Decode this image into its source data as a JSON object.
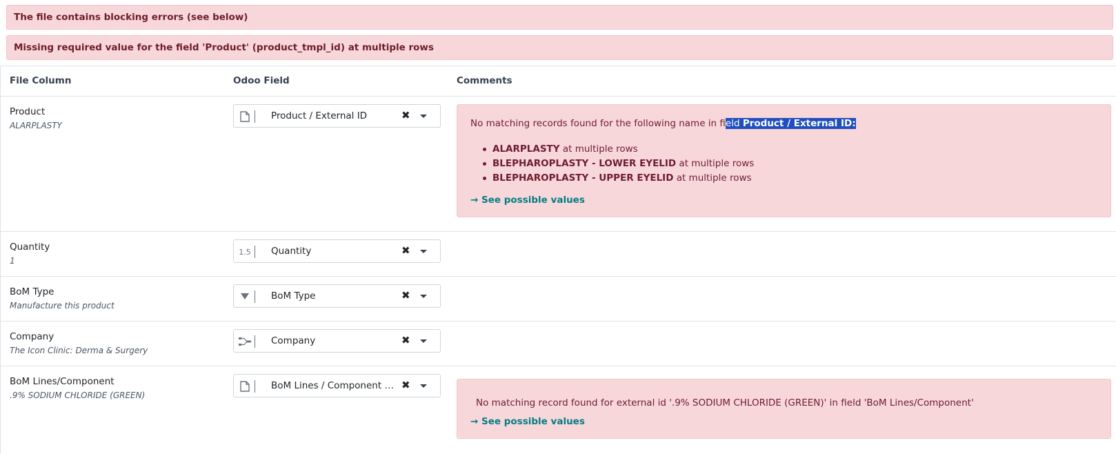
{
  "alerts": {
    "blocking": "The file contains blocking errors (see below)",
    "missing": "Missing required value for the field 'Product' (product_tmpl_id) at multiple rows"
  },
  "table": {
    "headers": {
      "file_column": "File Column",
      "odoo_field": "Odoo Field",
      "comments": "Comments"
    },
    "rows": [
      {
        "name": "Product",
        "sample": "ALARPLASTY",
        "field": "Product / External ID",
        "icon": "file-icon"
      },
      {
        "name": "Quantity",
        "sample": "1",
        "field": "Quantity",
        "icon": "float-icon",
        "icon_text": "1.5"
      },
      {
        "name": "BoM Type",
        "sample": "Manufacture this product",
        "field": "BoM Type",
        "icon": "selection-icon"
      },
      {
        "name": "Company",
        "sample": "The Icon Clinic: Derma & Surgery",
        "field": "Company",
        "icon": "many2one-icon"
      },
      {
        "name": "BoM Lines/Component",
        "sample": ".9% SODIUM CHLORIDE (GREEN)",
        "field": "BoM Lines / Component / External ID",
        "icon": "file-icon"
      }
    ]
  },
  "comments": {
    "product": {
      "prefix": "No matching records found for the following name in fi",
      "highlight_plain": "eld ",
      "highlight_bold": "Product / External ID:",
      "items": [
        {
          "name": "ALARPLASTY",
          "suffix": " at multiple rows"
        },
        {
          "name": "BLEPHAROPLASTY - LOWER EYELID",
          "suffix": " at multiple rows"
        },
        {
          "name": "BLEPHAROPLASTY - UPPER EYELID",
          "suffix": " at multiple rows"
        }
      ],
      "link": "→ See possible values"
    },
    "component": {
      "message": "No matching record found for external id '.9% SODIUM CHLORIDE (GREEN)' in field 'BoM Lines/Component'",
      "link": "→ See possible values"
    }
  },
  "colors": {
    "alert_bg": "#f8d7da",
    "alert_text": "#6e1d2b",
    "link": "#017e84",
    "selection": "#1f4fbf"
  }
}
